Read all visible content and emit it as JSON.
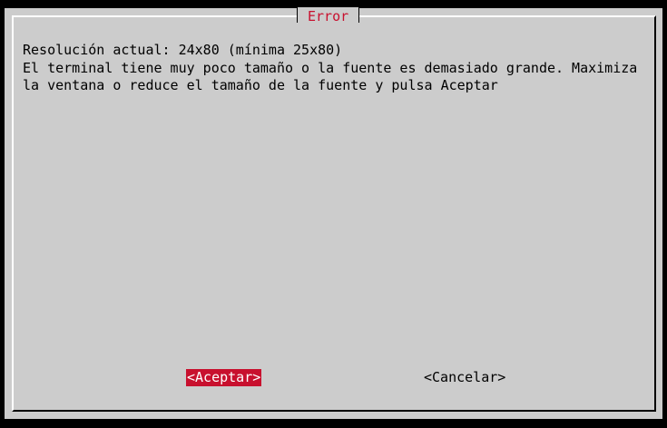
{
  "dialog": {
    "title": "Error",
    "message_lines": [
      "Resolución actual: 24x80 (mínima 25x80)",
      "El terminal tiene muy poco tamaño o la fuente es demasiado grande. Maximiza",
      "la ventana o reduce el tamaño de la fuente y pulsa Aceptar"
    ],
    "buttons": {
      "ok_label": "<Aceptar>",
      "cancel_label": "<Cancelar>"
    }
  },
  "colors": {
    "background": "#000000",
    "dialog": "#cccccc",
    "accent": "#c8102e",
    "text": "#000000"
  }
}
